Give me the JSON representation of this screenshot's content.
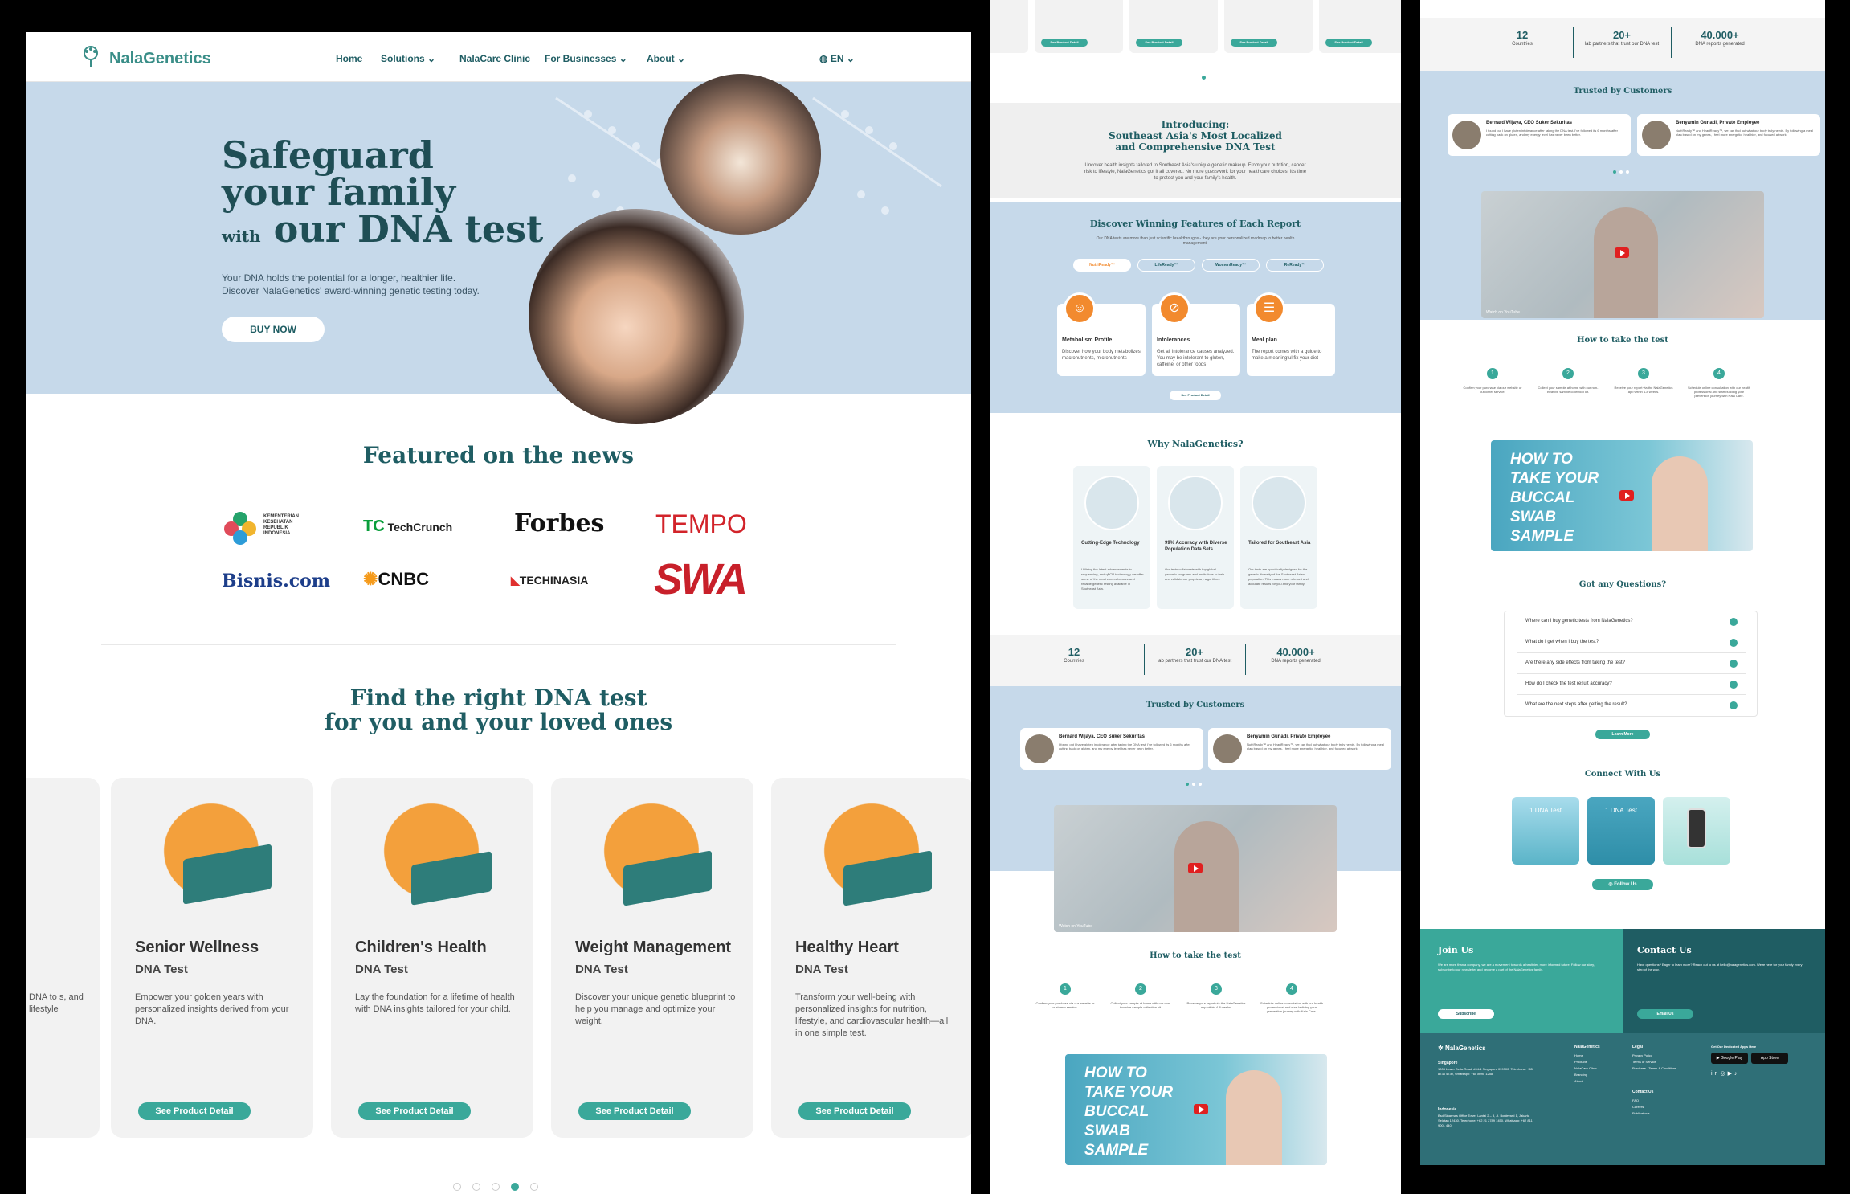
{
  "nav": {
    "brand": "NalaGenetics",
    "items": [
      "Home",
      "Solutions",
      "NalaCare Clinic",
      "For Businesses",
      "About"
    ],
    "lang": "EN"
  },
  "hero": {
    "line1": "Safeguard",
    "line2": "your family",
    "with": "with",
    "line3": "our DNA test",
    "desc1": "Your DNA holds the potential for a longer, healthier life.",
    "desc2": "Discover NalaGenetics' award-winning genetic testing today.",
    "cta": "BUY NOW"
  },
  "news": {
    "title": "Featured on the news",
    "logos": [
      "KEMENTERIAN KESEHATAN REPUBLIK INDONESIA",
      "TechCrunch",
      "Forbes",
      "TEMPO",
      "Bisnis.com",
      "CNBC",
      "TECHINASIA",
      "SWA"
    ]
  },
  "products": {
    "title1": "Find the right DNA test",
    "title2": "for you and your loved ones",
    "partial_desc": "DNA to s, and lifestyle",
    "cards": [
      {
        "name": "Senior Wellness",
        "sub": "DNA Test",
        "desc": "Empower your golden years with personalized insights derived from your DNA.",
        "cta": "See Product Detail"
      },
      {
        "name": "Children's Health",
        "sub": "DNA Test",
        "desc": "Lay the foundation for a lifetime of health with DNA insights tailored for your child.",
        "cta": "See Product Detail"
      },
      {
        "name": "Weight Management",
        "sub": "DNA Test",
        "desc": "Discover your unique genetic blueprint to help you manage and optimize your weight.",
        "cta": "See Product Detail"
      },
      {
        "name": "Healthy Heart",
        "sub": "DNA Test",
        "desc": "Transform your well-being with personalized insights for nutrition, lifestyle, and cardiovascular health—all in one simple test.",
        "cta": "See Product Detail"
      }
    ]
  },
  "p2": {
    "top_ctas": [
      "See Product Detail",
      "See Product Detail",
      "See Product Detail",
      "See Product Detail"
    ],
    "intro_kicker": "Introducing:",
    "intro_l1": "Southeast Asia's Most Localized",
    "intro_l2": "and Comprehensive DNA Test",
    "intro_desc": "Uncover health insights tailored to Southeast Asia's unique genetic makeup. From your nutrition, cancer risk to lifestyle, NalaGenetics got it all covered. No more guesswork for your healthcare choices, it's time to protect you and your family's health.",
    "features_title": "Discover Winning Features of Each Report",
    "features_desc": "Our DNA tests are more than just scientific breakthroughs - they are your personalized roadmap to better health management.",
    "tabs": [
      "NutriReady™",
      "LifeReady™",
      "WomenReady™",
      "ReReady™"
    ],
    "features": [
      {
        "title": "Metabolism Profile",
        "desc": "Discover how your body metabolizes macronutrients, micronutrients"
      },
      {
        "title": "Intolerances",
        "desc": "Get all intolerance causes analyzed. You may be intolerant to gluten, caffeine, or other foods"
      },
      {
        "title": "Meal plan",
        "desc": "The report comes with a guide to make a meaningful fix your diet"
      }
    ],
    "features_cta": "See Product Detail",
    "why_title": "Why NalaGenetics?",
    "why": [
      {
        "title": "Cutting-Edge Technology",
        "desc": "Utilizing the latest advancements in sequencing, and qPCR technology, we offer some of the most comprehensive and reliable genetic testing available in Southeast Asia."
      },
      {
        "title": "99% Accuracy with Diverse Population Data Sets",
        "desc": "Our tests collaborate with top global genomic programs and institutions to train and validate our proprietary algorithms."
      },
      {
        "title": "Tailored for Southeast Asia",
        "desc": "Our tests are specifically designed for the genetic diversity of the Southeast Asian population. This means more relevant and accurate results for you and your family."
      }
    ],
    "stats": [
      {
        "value": "12",
        "label": "Countries"
      },
      {
        "value": "20+",
        "label": "lab partners that trust our DNA test"
      },
      {
        "value": "40.000+",
        "label": "DNA reports generated"
      }
    ],
    "trusted_title": "Trusted by Customers",
    "testimonials": [
      {
        "name": "Bernard Wijaya, CEO Suker Sekuritas",
        "text": "I found out I have gluten intolerance after taking the DNA test. I've followed its 6 months after cutting back on gluten, and my energy level has never been better."
      },
      {
        "name": "Benyamin Gunadi, Private Employee",
        "text": "NutriReady™ and HeartReady™, we can find out what our body truly needs. By following a meal plan based on my genes, I feel more energetic, healthier, and focused at work."
      }
    ],
    "steps_title": "How to take the test",
    "steps": [
      {
        "n": "1",
        "desc": "Confirm your purchase via our website or customer service."
      },
      {
        "n": "2",
        "desc": "Collect your sample at home with our non-invasive sample collection kit."
      },
      {
        "n": "3",
        "desc": "Receive your report via the NalaGenetics app within 4-8 weeks."
      },
      {
        "n": "4",
        "desc": "Schedule online consultation with our health professional and start building your prevention journey with Nala Care."
      }
    ],
    "swab_l1": "HOW TO",
    "swab_l2": "TAKE YOUR",
    "swab_l3": "BUCCAL",
    "swab_l4": "SWAB",
    "swab_l5": "SAMPLE",
    "video_caption": "Watch on YouTube"
  },
  "p3": {
    "faq_title": "Got any Questions?",
    "faqs": [
      "Where can I buy genetic tests from NalaGenetics?",
      "What do I get when I buy the test?",
      "Are there any side effects from taking the test?",
      "How do I check the test result accuracy?",
      "What are the next steps after getting the result?"
    ],
    "learn_more": "Learn More",
    "connect_title": "Connect With Us",
    "connect_tiles": [
      "1 DNA Test",
      "1 DNA Test"
    ],
    "follow": "Follow Us",
    "join_title": "Join Us",
    "join_desc": "We are more than a company, we are a movement towards a healthier, more informed future. Follow our story, subscribe to our newsletter and become a part of the NalaGenetics family.",
    "subscribe": "Subscribe",
    "contact_title": "Contact Us",
    "contact_desc": "Have questions? Eager to learn more? Reach out to us at hello@nalagenetics.com. We're here for your family every step of the way.",
    "email_btn": "Email Us",
    "footer_brand": "NalaGenetics",
    "sg_title": "Singapore",
    "sg_addr": "1003 Lower Delta Road, #04-1 Singapore 099300, Telephone: +65 8738 4730, Whatsapp: +65 8090 1258",
    "id_title": "Indonesia",
    "id_addr": "Bsd Sinarmas Office Tower Lantai 2 – 3, Jl. Boulevard 1, Jakarta Selatan 12430, Telephone: +62 21 2789 1450, Whatsapp: +62 811 9001 440",
    "col1_title": "NalaGenetics",
    "col1": [
      "Home",
      "Products",
      "NalaCare Clinic",
      "Branding",
      "About"
    ],
    "col2_title": "Legal",
    "col2": [
      "Privacy Policy",
      "Terms of Service",
      "Purchase - Terms & Conditions"
    ],
    "col3_title": "Contact Us",
    "col3": [
      "FAQ",
      "Careers",
      "Publications"
    ],
    "app_title": "Get Our Dedicated Apps Here",
    "google_play": "Google Play",
    "app_store": "App Store"
  },
  "colors": {
    "teal": "#3aa89a",
    "navy": "#1f5d63",
    "hero_bg": "#c6d9ea",
    "orange": "#f28a2e",
    "footer": "#2f6f77"
  }
}
